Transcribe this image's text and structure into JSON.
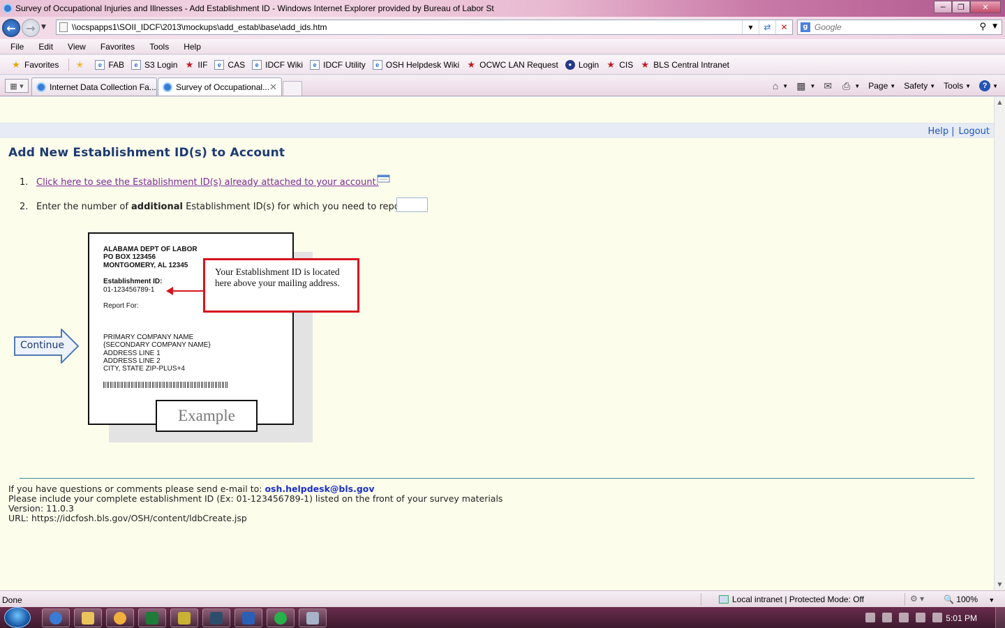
{
  "window": {
    "title": "Survey of Occupational Injuries and Illnesses - Add Establishment ID - Windows Internet Explorer provided by Bureau of Labor St"
  },
  "addressbar": {
    "url": "\\\\ocspapps1\\SOII_IDCF\\2013\\mockups\\add_estab\\base\\add_ids.htm",
    "search_placeholder": "Google"
  },
  "menu": [
    "File",
    "Edit",
    "View",
    "Favorites",
    "Tools",
    "Help"
  ],
  "favorites": {
    "label": "Favorites",
    "items": [
      {
        "label": "FAB",
        "icon": "page-icon"
      },
      {
        "label": "S3 Login",
        "icon": "page-icon"
      },
      {
        "label": "IIF",
        "icon": "red-star-icon"
      },
      {
        "label": "CAS",
        "icon": "page-icon"
      },
      {
        "label": "IDCF Wiki",
        "icon": "page-icon"
      },
      {
        "label": "IDCF Utility",
        "icon": "page-icon"
      },
      {
        "label": "OSH Helpdesk Wiki",
        "icon": "page-icon"
      },
      {
        "label": "OCWC LAN Request",
        "icon": "red-star-icon"
      },
      {
        "label": "Login",
        "icon": "seal-icon"
      },
      {
        "label": "CIS",
        "icon": "red-star-icon"
      },
      {
        "label": "BLS Central Intranet",
        "icon": "red-star-icon"
      }
    ]
  },
  "tabs": [
    {
      "label": "Internet Data Collection Fa..."
    },
    {
      "label": "Survey of Occupational..."
    }
  ],
  "commandbar": {
    "page": "Page",
    "safety": "Safety",
    "tools": "Tools"
  },
  "page": {
    "help": "Help",
    "logout": "Logout",
    "heading": "Add New Establishment ID(s) to Account",
    "step1_num": "1.",
    "step1_link": "Click here to see the Establishment ID(s) already attached to your account.",
    "step2_num": "2.",
    "step2_pre": "Enter the number of ",
    "step2_bold": "additional",
    "step2_post": " Establishment ID(s) for which you need to report.",
    "continue": "Continue"
  },
  "example": {
    "org": "ALABAMA DEPT OF LABOR",
    "pobox": "PO BOX 123456",
    "city": "MONTGOMERY, AL 12345",
    "id_label": "Establishment ID:",
    "id_value": "01-123456789-1",
    "report_for": "Report For:",
    "company1": "PRIMARY COMPANY NAME",
    "company2": "{SECONDARY COMPANY NAME}",
    "addr1": "ADDRESS LINE 1",
    "addr2": "ADDRESS LINE 2",
    "city_state": "CITY, STATE  ZIP-PLUS+4",
    "label": "Example",
    "callout": "Your Establishment ID is located here above your mailing address."
  },
  "footer": {
    "questions": "If you have questions or comments please send e-mail to: ",
    "email": "osh.helpdesk@bls.gov",
    "include": "Please include your complete establishment ID (Ex: 01-123456789-1) listed on the front of your survey materials",
    "version": "Version: 11.0.3",
    "url": "URL: https://idcfosh.bls.gov/OSH/content/ldbCreate.jsp"
  },
  "statusbar": {
    "status": "Done",
    "zone": "Local intranet | Protected Mode: Off",
    "zoom": "100%"
  },
  "taskbar": {
    "clock": "5:01 PM"
  },
  "colors": {
    "heading": "#1d3a72",
    "link_visited": "#7a2a9a",
    "callout_border": "#d7141d",
    "content_bg": "#fdfdec"
  }
}
